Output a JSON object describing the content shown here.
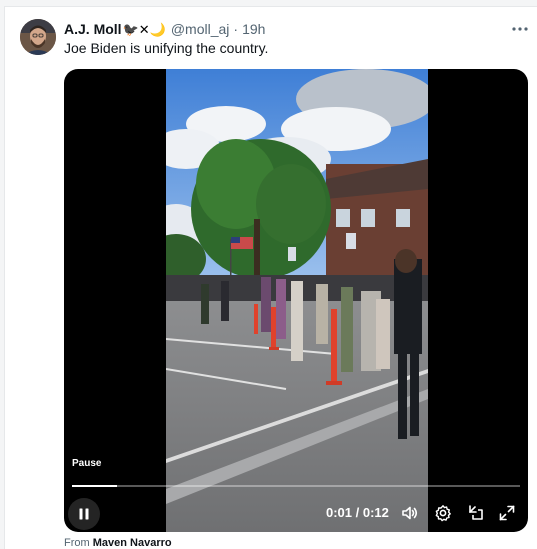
{
  "tweet": {
    "author_name": "A.J. Moll",
    "author_emojis": "🐦‍⬛✕🌙",
    "handle": "@moll_aj",
    "separator": "·",
    "time": "19h",
    "text": "Joe Biden is unifying the country.",
    "more_icon": "more-horizontal-icon"
  },
  "video": {
    "state_label": "Pause",
    "current_time": "0:01",
    "duration": "0:12",
    "time_separator": " / ",
    "progress_fraction": 0.1,
    "controls": [
      "pause-icon",
      "volume-icon",
      "settings-icon",
      "minimize-icon",
      "fullscreen-icon"
    ]
  },
  "attribution": {
    "prefix": "From ",
    "source": "Maven Navarro"
  },
  "colors": {
    "text_primary": "#0f1419",
    "text_secondary": "#536471",
    "player_bg": "#000000"
  }
}
